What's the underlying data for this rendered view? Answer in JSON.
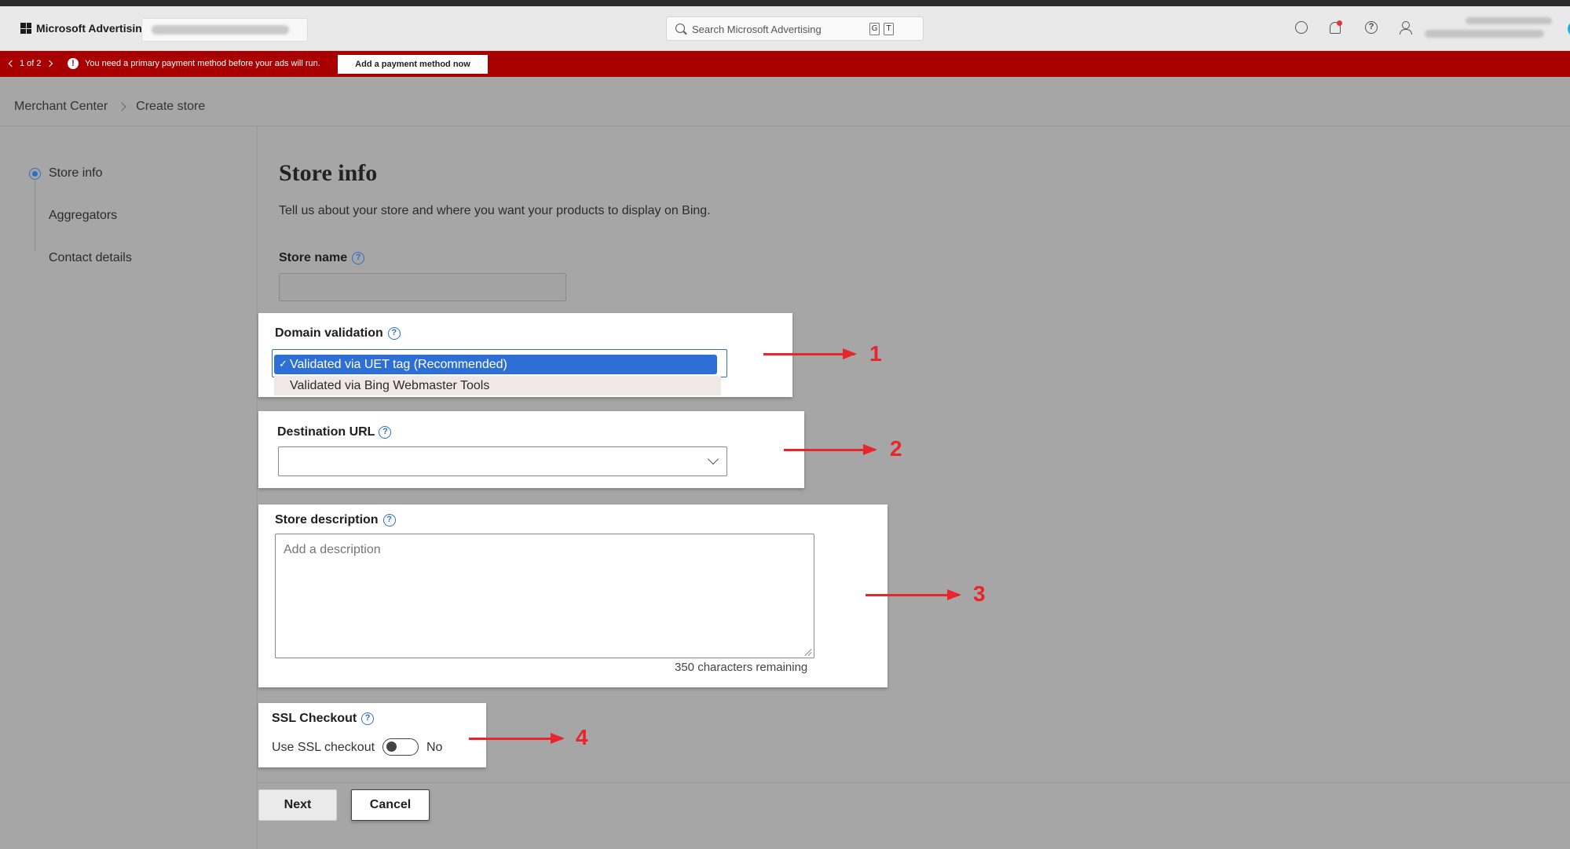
{
  "header": {
    "brand": "Microsoft Advertising",
    "search_placeholder": "Search Microsoft Advertising",
    "kbd_g": "G",
    "kbd_t": "T",
    "help_glyph": "?"
  },
  "banner": {
    "pager": "1 of 2",
    "message": "You need a primary payment method before your ads will run.",
    "action_label": "Add a payment method now",
    "warn_glyph": "!",
    "color": "#a80000"
  },
  "breadcrumb": {
    "items": [
      "Merchant Center",
      "Create store"
    ]
  },
  "steps": [
    {
      "label": "Store info",
      "active": true
    },
    {
      "label": "Aggregators",
      "active": false
    },
    {
      "label": "Contact details",
      "active": false
    }
  ],
  "main": {
    "title": "Store info",
    "subtitle": "Tell us about your store and where you want your products to display on Bing.",
    "store_name": {
      "label": "Store name",
      "value": ""
    },
    "domain_validation": {
      "label": "Domain validation",
      "check_glyph": "✓",
      "options": [
        "Validated via UET tag (Recommended)",
        "Validated via Bing Webmaster Tools"
      ],
      "selected": "Validated via UET tag (Recommended)"
    },
    "destination_url": {
      "label": "Destination URL",
      "value": ""
    },
    "store_description": {
      "label": "Store description",
      "placeholder": "Add a description",
      "char_count": "350 characters remaining"
    },
    "ssl_checkout": {
      "label": "SSL Checkout",
      "toggle_label": "Use SSL checkout",
      "toggle_state": "No"
    },
    "help_glyph": "?"
  },
  "footer": {
    "next_label": "Next",
    "cancel_label": "Cancel"
  },
  "annotations": {
    "numbers": [
      "1",
      "2",
      "3",
      "4"
    ],
    "color": "#e8252b"
  },
  "icons": [
    "microsoft-logo-icon",
    "search-icon",
    "copilot-icon",
    "rewards-icon",
    "bell-icon",
    "help-icon",
    "person-icon",
    "chevron-left-icon",
    "chevron-right-icon",
    "warning-icon",
    "chevron-down-icon",
    "checkmark-icon"
  ]
}
